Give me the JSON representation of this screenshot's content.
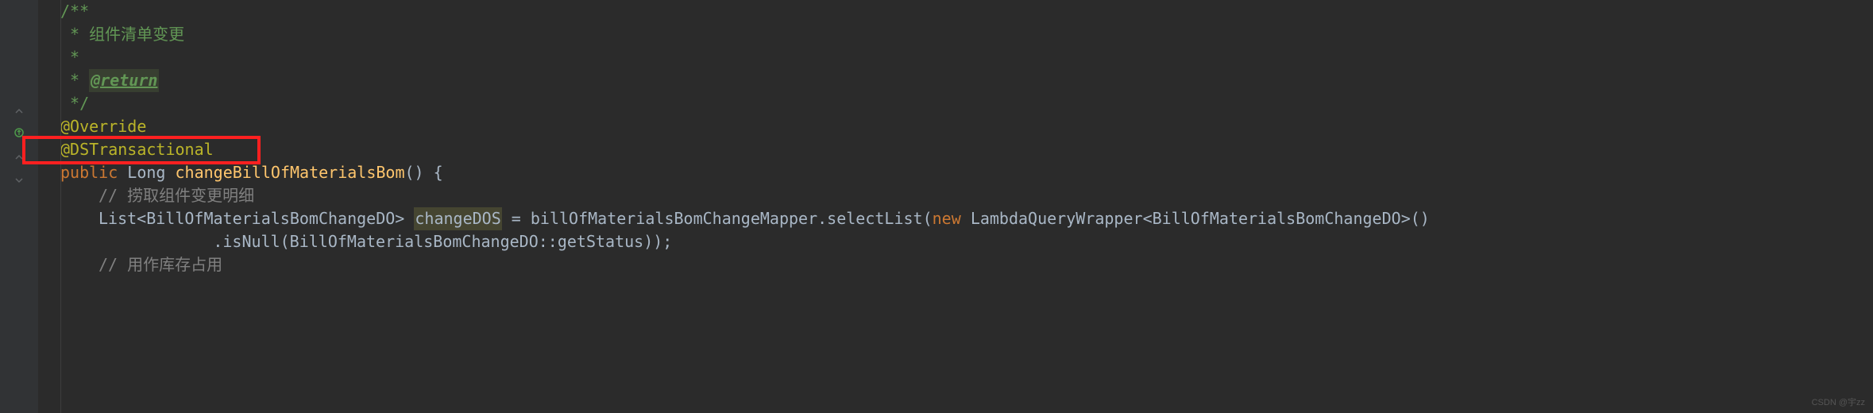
{
  "gutter": {
    "lines": [
      {
        "type": "blank"
      },
      {
        "type": "blank"
      },
      {
        "type": "blank"
      },
      {
        "type": "blank"
      },
      {
        "type": "fold-close"
      },
      {
        "type": "override"
      },
      {
        "type": "fold-close"
      },
      {
        "type": "fold-open-error"
      },
      {
        "type": "blank"
      },
      {
        "type": "blank"
      },
      {
        "type": "blank"
      },
      {
        "type": "blank"
      }
    ]
  },
  "code": {
    "line1": {
      "prefix": "/**"
    },
    "line2": {
      "prefix": " * ",
      "text": "组件清单变更"
    },
    "line3": {
      "prefix": " *"
    },
    "line4": {
      "prefix": " * ",
      "tag": "@return"
    },
    "line5": {
      "prefix": " */"
    },
    "line6": {
      "annotation": "@Override"
    },
    "line7": {
      "annotation": "@DSTransactional"
    },
    "line8": {
      "keyword": "public",
      "type": "Long",
      "method": "changeBillOfMaterialsBom",
      "suffix": "() {"
    },
    "line9": {
      "comment": "// 捞取组件变更明细"
    },
    "line10": {
      "type1": "List",
      "generic1": "BillOfMaterialsBomChangeDO",
      "var": "changeDOS",
      "eq": " = ",
      "obj": "billOfMaterialsBomChangeMapper",
      "dot1": ".",
      "method1": "selectList",
      "paren1": "(",
      "keyword_new": "new",
      "type2": "LambdaQueryWrapper",
      "generic2": "BillOfMaterialsBomChangeDO",
      "suffix": ">()"
    },
    "line11": {
      "prefix": "        .",
      "method": "isNull",
      "paren1": "(",
      "ref": "BillOfMaterialsBomChangeDO",
      "dcolon": "::",
      "getter": "getStatus",
      "suffix": "));"
    },
    "line12": {
      "comment": "// 用作库存占用"
    }
  },
  "highlight": {
    "present": true
  },
  "watermark": "CSDN @宇zz"
}
